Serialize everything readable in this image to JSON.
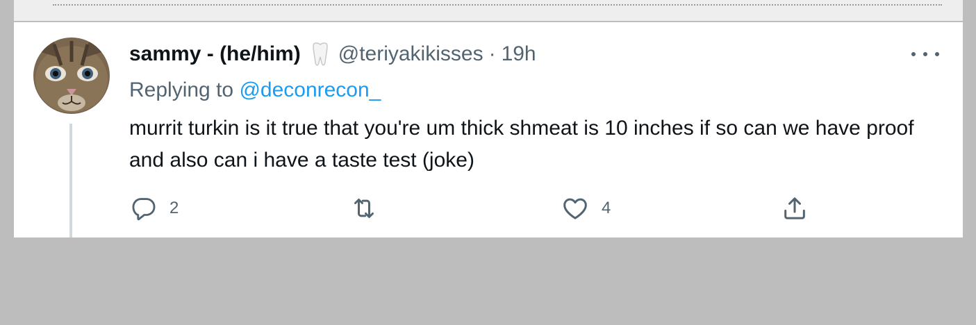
{
  "tweet": {
    "display_name": "sammy - (he/him)",
    "name_emoji": "tooth-icon",
    "handle": "@teriyakikisses",
    "separator": "·",
    "time": "19h",
    "replying_prefix": "Replying to",
    "replying_to": "@deconrecon_",
    "text": "murrit turkin is it true that you're um thick shmeat is 10 inches if so can we have proof and also can i have a taste test (joke)"
  },
  "actions": {
    "reply_count": "2",
    "retweet_count": "",
    "like_count": "4"
  },
  "icons": {
    "more": "more-horizontal-icon",
    "reply": "reply-icon",
    "retweet": "retweet-icon",
    "like": "heart-icon",
    "share": "share-icon"
  },
  "colors": {
    "text_primary": "#0f1419",
    "text_secondary": "#536471",
    "link": "#1d9bf0",
    "thread_line": "#cfd9de",
    "background": "#bdbdbd"
  }
}
